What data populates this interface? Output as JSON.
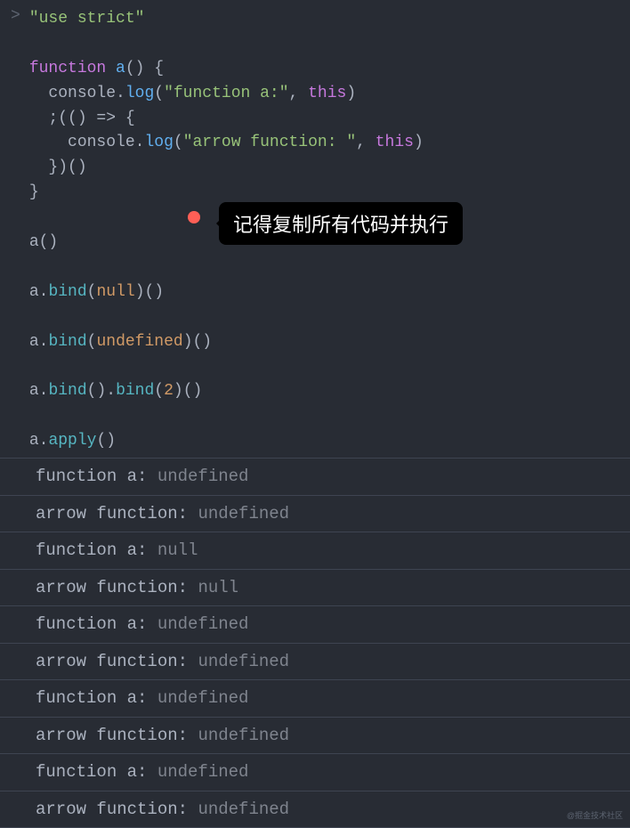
{
  "prompt": ">",
  "code": {
    "line1": "\"use strict\"",
    "func_kw": "function",
    "func_name": "a",
    "func_parens": "()",
    "brace_open": " {",
    "l3_indent": "  ",
    "console": "console",
    "dot": ".",
    "log": "log",
    "str_fa": "\"function a:\"",
    "comma_sp": ", ",
    "this": "this",
    "close_paren": ")",
    "open_paren": "(",
    "l4_prefix": "  ;((",
    "arrow": ") => {",
    "l5_indent": "    ",
    "str_arrow": "\"arrow function: \"",
    "l6": "  })()",
    "brace_close": "}",
    "call_a": "a()",
    "a": "a",
    "bind": "bind",
    "null": "null",
    "undefined": "undefined",
    "two": "2",
    "apply": "apply",
    "empty_parens": "()"
  },
  "tooltip": "记得复制所有代码并执行",
  "output": [
    {
      "label": "function a:",
      "val": "undefined",
      "sp": " "
    },
    {
      "label": "arrow function: ",
      "val": "undefined",
      "sp": " "
    },
    {
      "label": "function a:",
      "val": "null",
      "sp": " "
    },
    {
      "label": "arrow function: ",
      "val": "null",
      "sp": " "
    },
    {
      "label": "function a:",
      "val": "undefined",
      "sp": " "
    },
    {
      "label": "arrow function: ",
      "val": "undefined",
      "sp": " "
    },
    {
      "label": "function a:",
      "val": "undefined",
      "sp": " "
    },
    {
      "label": "arrow function: ",
      "val": "undefined",
      "sp": " "
    },
    {
      "label": "function a:",
      "val": "undefined",
      "sp": " "
    },
    {
      "label": "arrow function: ",
      "val": "undefined",
      "sp": " "
    }
  ],
  "watermark": "@掘金技术社区"
}
